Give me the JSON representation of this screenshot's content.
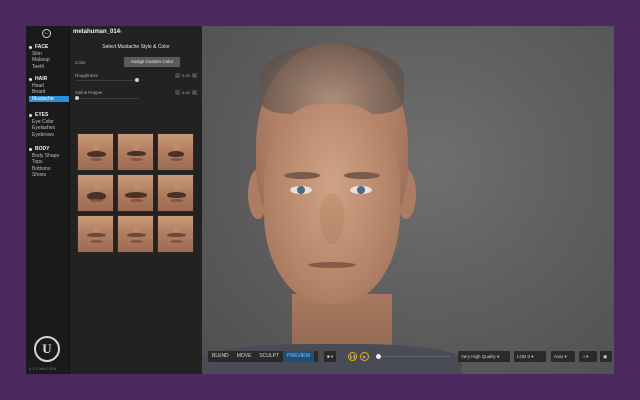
{
  "app": {
    "character_name": "metahuman_014",
    "version": "0.1.0 MHC.508"
  },
  "nav": {
    "sections": [
      {
        "title": "FACE",
        "items": [
          "Skin",
          "Makeup",
          "Teeth"
        ]
      },
      {
        "title": "HAIR",
        "items": [
          "Head",
          "Beard",
          "Mustache"
        ]
      },
      {
        "title": "EYES",
        "items": [
          "Eye Color",
          "Eyelashes",
          "Eyebrows"
        ]
      },
      {
        "title": "BODY",
        "items": [
          "Body Shape",
          "Tops",
          "Bottoms",
          "Shoes"
        ]
      }
    ],
    "active_item": "Mustache"
  },
  "panel": {
    "title": "Select Mustache Style & Color",
    "color_label": "Color",
    "custom_color_button": "Assign Custom Color",
    "roughness_label": "Roughness",
    "roughness_value": "0.00",
    "salt_pepper_label": "Salt & Pepper",
    "salt_pepper_value": "0.00"
  },
  "toolbar": {
    "modes": [
      "BLEND",
      "MOVE",
      "SCULPT",
      "PREVIEW"
    ],
    "active_mode": "PREVIEW",
    "quality": "Very High Quality",
    "lod": "LOD 0",
    "auto": "Auto"
  },
  "colors": {
    "accent": "#2c8fd8",
    "preview_active": "#1f4e78",
    "playback": "#e2b02a",
    "backdrop": "#4a2a5e"
  }
}
